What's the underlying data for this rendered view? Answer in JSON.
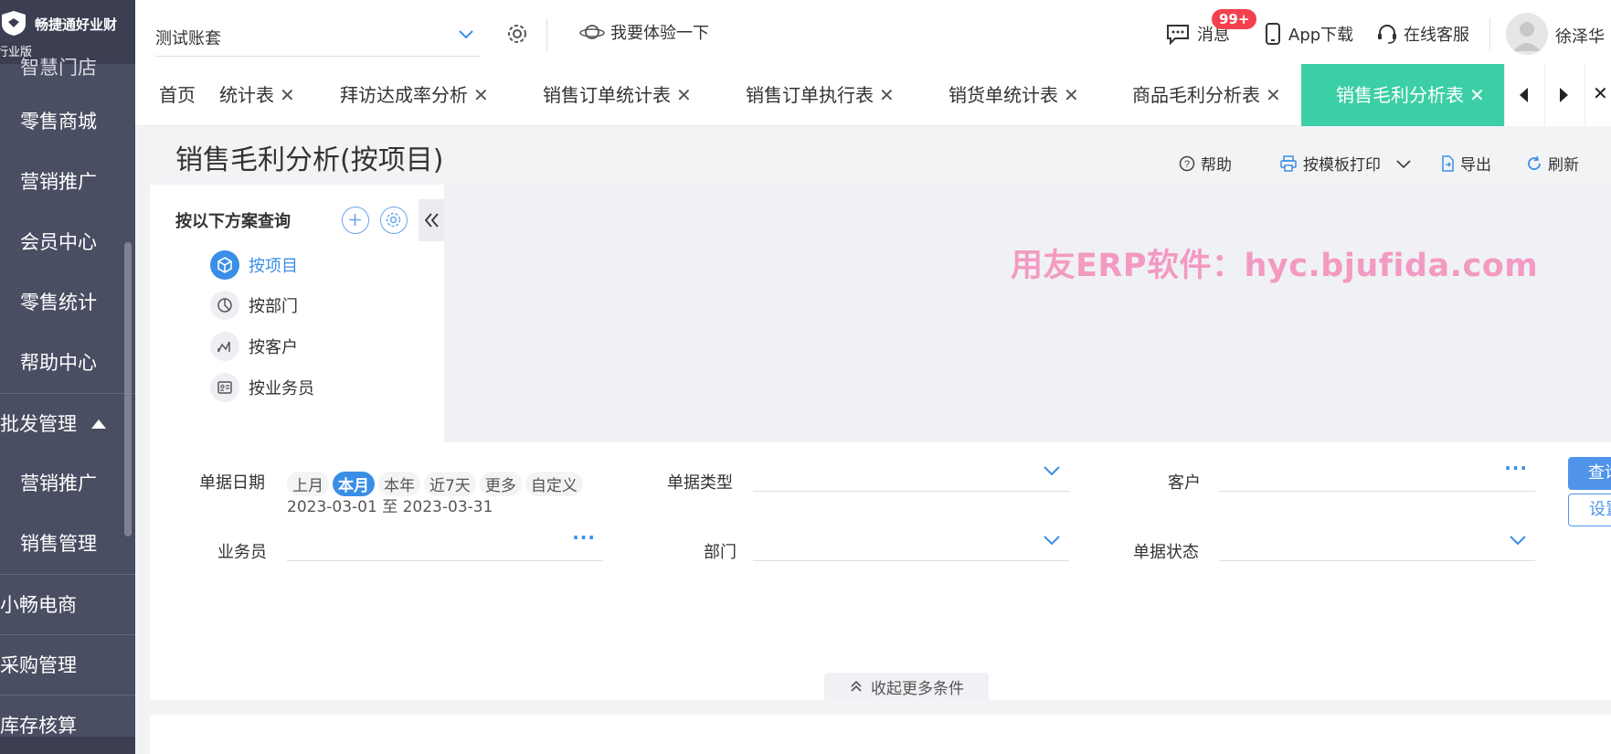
{
  "brand": {
    "name": "畅捷通好业财",
    "edition": "行业版"
  },
  "sidebar": {
    "items": [
      {
        "label": "智慧门店",
        "kind": "partial"
      },
      {
        "label": "零售商城",
        "kind": "sub"
      },
      {
        "label": "营销推广",
        "kind": "sub"
      },
      {
        "label": "会员中心",
        "kind": "sub"
      },
      {
        "label": "零售统计",
        "kind": "sub"
      },
      {
        "label": "帮助中心",
        "kind": "sub"
      },
      {
        "label": "批发管理",
        "kind": "top",
        "expanded": true
      },
      {
        "label": "营销推广",
        "kind": "sub"
      },
      {
        "label": "销售管理",
        "kind": "sub"
      },
      {
        "label": "小畅电商",
        "kind": "top"
      },
      {
        "label": "采购管理",
        "kind": "top"
      },
      {
        "label": "库存核算",
        "kind": "top"
      }
    ]
  },
  "topbar": {
    "account": "测试账套",
    "try_label": "我要体验一下",
    "messages_label": "消息",
    "messages_badge": "99+",
    "app_label": "App下载",
    "service_label": "在线客服",
    "user_name": "徐泽华"
  },
  "tabs": [
    {
      "label": "首页",
      "closable": false
    },
    {
      "label": "统计表",
      "closable": true
    },
    {
      "label": "拜访达成率分析",
      "closable": true
    },
    {
      "label": "销售订单统计表",
      "closable": true
    },
    {
      "label": "销售订单执行表",
      "closable": true
    },
    {
      "label": "销货单统计表",
      "closable": true
    },
    {
      "label": "商品毛利分析表",
      "closable": true
    },
    {
      "label": "销售毛利分析表",
      "closable": true,
      "active": true
    }
  ],
  "page": {
    "title": "销售毛利分析(按项目)",
    "actions": {
      "help": "帮助",
      "print": "按模板打印",
      "export": "导出",
      "refresh": "刷新"
    }
  },
  "scheme": {
    "heading": "按以下方案查询",
    "items": [
      {
        "label": "按项目",
        "icon": "cube-icon",
        "active": true
      },
      {
        "label": "按部门",
        "icon": "pie-icon"
      },
      {
        "label": "按客户",
        "icon": "chart-icon"
      },
      {
        "label": "按业务员",
        "icon": "id-card-icon"
      }
    ]
  },
  "watermark": "用友ERP软件：hyc.bjufida.com",
  "filters": {
    "date_label": "单据日期",
    "quick": [
      "上月",
      "本月",
      "本年",
      "近7天",
      "更多",
      "自定义"
    ],
    "quick_selected": "本月",
    "date_range": "2023-03-01 至 2023-03-31",
    "doc_type_label": "单据类型",
    "customer_label": "客户",
    "salesman_label": "业务员",
    "dept_label": "部门",
    "status_label": "单据状态",
    "query_btn": "查询",
    "settings_btn": "设置",
    "collapse_more": "收起更多条件"
  },
  "colors": {
    "accent": "#3ccfa6",
    "primary": "#3a8ee6",
    "sidebar": "#4a4e63",
    "badge": "#f5404d",
    "watermark": "#f39ac2"
  }
}
